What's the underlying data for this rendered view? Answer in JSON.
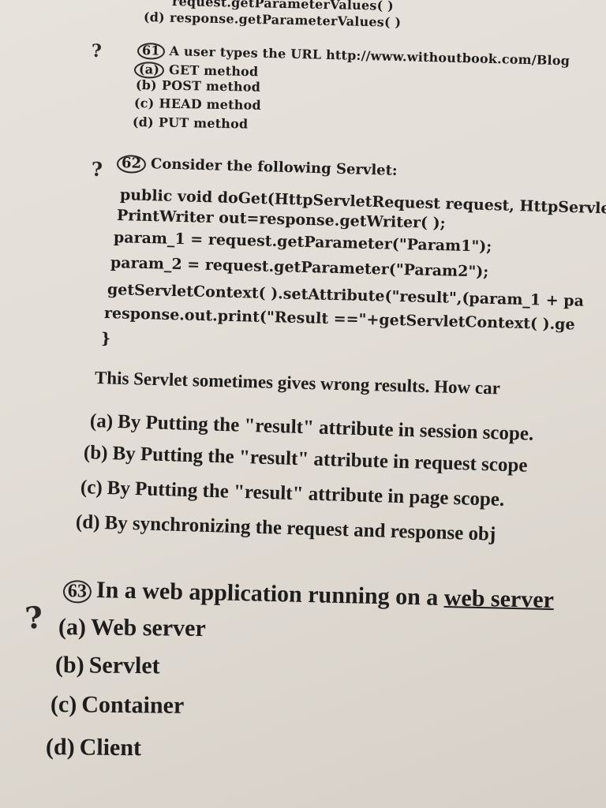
{
  "top": {
    "c_line": "request.getParameterValues( )",
    "d_label": "(d)",
    "d_line": "response.getParameterValues( )"
  },
  "q61": {
    "number": "61",
    "stem": "A user types the URL http://www.withoutbook.com/Blog",
    "options": [
      {
        "label": "(a)",
        "text": "GET method"
      },
      {
        "label": "(b)",
        "text": "POST method"
      },
      {
        "label": "(c)",
        "text": "HEAD method"
      },
      {
        "label": "(d)",
        "text": "PUT method"
      }
    ],
    "margin_mark": "?"
  },
  "q62": {
    "number": "62",
    "stem": "Consider the following Servlet:",
    "code": [
      "public void doGet(HttpServletRequest request, HttpServle",
      "PrintWriter out=response.getWriter( );",
      "param_1 = request.getParameter(\"Param1\");",
      "param_2 = request.getParameter(\"Param2\");",
      "getServletContext( ).setAttribute(\"result\",(param_1 + pa",
      "response.out.print(\"Result ==\"+getServletContext( ).ge",
      "}"
    ],
    "question": "This Servlet sometimes gives wrong results. How car",
    "options": [
      {
        "label": "(a)",
        "text": "By Putting the \"result\" attribute in session scope."
      },
      {
        "label": "(b)",
        "text": "By Putting the \"result\" attribute in request scope"
      },
      {
        "label": "(c)",
        "text": "By Putting the \"result\" attribute in page scope."
      },
      {
        "label": "(d)",
        "text": "By synchronizing the request and response obj"
      }
    ],
    "margin_mark": "?"
  },
  "q63": {
    "number": "63",
    "stem_before": "In a web application  running on a ",
    "stem_underlined": "web server",
    "options": [
      {
        "label": "(a)",
        "text": "Web server"
      },
      {
        "label": "(b)",
        "text": "Servlet"
      },
      {
        "label": "(c)",
        "text": "Container"
      },
      {
        "label": "(d)",
        "text": "Client"
      }
    ],
    "margin_mark": "?"
  }
}
